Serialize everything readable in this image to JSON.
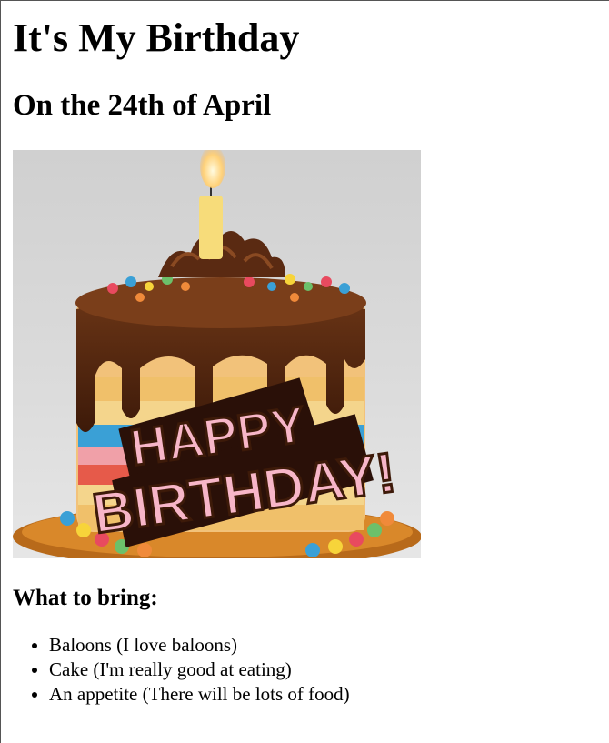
{
  "page": {
    "title": "It's My Birthday",
    "subtitle": "On the 24th of April",
    "image": {
      "icon": "birthday-cake-image",
      "banner_line1": "HAPPY",
      "banner_line2": "BIRTHDAY!"
    },
    "bring_heading": "What to bring:",
    "bring_items": [
      "Baloons (I love baloons)",
      "Cake (I'm really good at eating)",
      "An appetite (There will be lots of food)"
    ]
  },
  "colors": {
    "background": "#ffffff",
    "image_bg": "#d3d3d3",
    "chocolate": "#5a2a12",
    "banner_pink": "#f7b6c8"
  }
}
